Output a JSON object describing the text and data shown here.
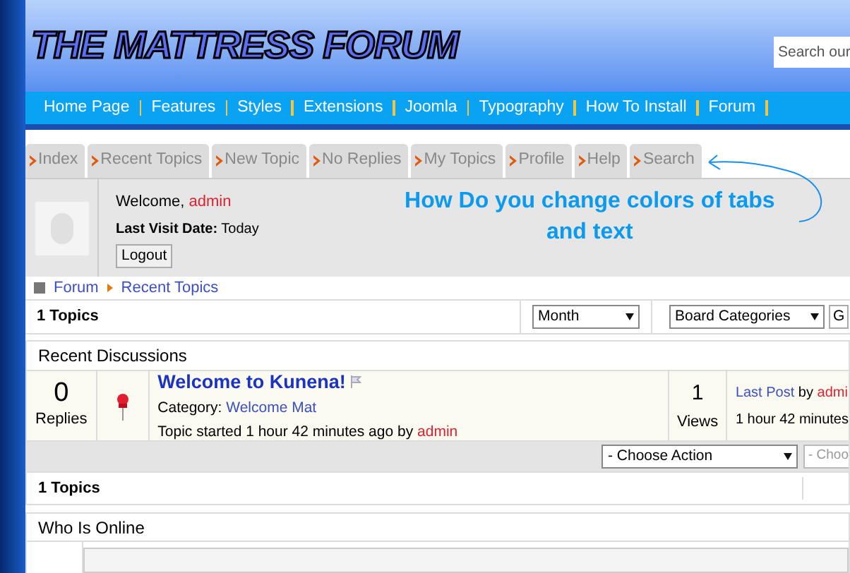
{
  "header": {
    "logo": "THE MATTRESS FORUM",
    "search": {
      "placeholder": "Search our"
    }
  },
  "nav": [
    "Home Page",
    "Features",
    "Styles",
    "Extensions",
    "Joomla",
    "Typography",
    "How To Install",
    "Forum"
  ],
  "tabs": [
    {
      "label": "Index",
      "selected": false
    },
    {
      "label": "Recent Topics",
      "selected": false
    },
    {
      "label": "New Topic",
      "selected": false
    },
    {
      "label": "No Replies",
      "selected": false
    },
    {
      "label": "My Topics",
      "selected": false
    },
    {
      "label": "Profile",
      "selected": false
    },
    {
      "label": "Help",
      "selected": false
    },
    {
      "label": "Search",
      "selected": false
    }
  ],
  "annotation": "How Do you change colors of tabs and text",
  "profile": {
    "welcome": "Welcome,",
    "user": "admin",
    "last_visit_label": "Last Visit Date:",
    "last_visit": "Today",
    "logout": "Logout"
  },
  "breadcrumb": [
    "Forum",
    "Recent Topics"
  ],
  "topics_bar": {
    "count": "1 Topics",
    "period": "Month",
    "category": "Board Categories",
    "go": "G"
  },
  "section_title": "Recent Discussions",
  "topic": {
    "replies": "0",
    "replies_label": "Replies",
    "title": "Welcome to Kunena!",
    "category_label": "Category:",
    "category": "Welcome Mat",
    "started": "Topic started 1 hour 42 minutes ago",
    "by": "by",
    "author": "admin",
    "views": "1",
    "views_label": "Views",
    "last_post": "Last Post",
    "last_by": "by",
    "last_author": "admi",
    "last_time": "1 hour 42 minutes"
  },
  "actions": [
    "- Choose Action",
    "- Choo"
  ],
  "bottom_count": "1 Topics",
  "online_title": "Who Is Online"
}
